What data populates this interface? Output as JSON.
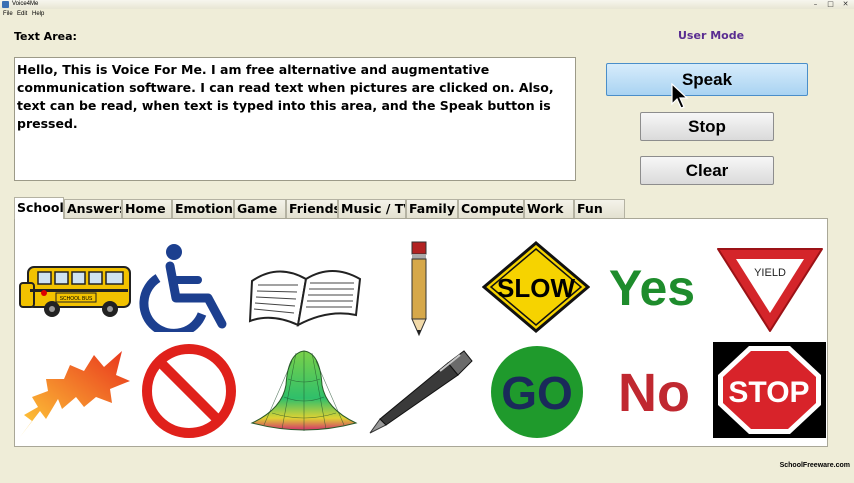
{
  "window": {
    "title": "Voice4Me"
  },
  "menu": [
    "File",
    "Edit",
    "Help"
  ],
  "labels": {
    "text_area": "Text Area:",
    "mode": "User Mode"
  },
  "text_area": {
    "value": "Hello, This is Voice For Me. I am free alternative and augmentative communication software. I can read text when pictures are clicked on. Also, text can be read, when text is typed into this area, and the Speak button is pressed."
  },
  "buttons": {
    "speak": "Speak",
    "stop": "Stop",
    "clear": "Clear"
  },
  "tabs": [
    "School",
    "Answers",
    "Home",
    "Emotions",
    "Game",
    "Friends",
    "Music / TV",
    "Family",
    "Computer",
    "Work",
    "Fun"
  ],
  "active_tab": "School",
  "pictures": {
    "bus_sign": "SCHOOL BUS",
    "slow": "SLOW",
    "yes": "Yes",
    "yield": "YIELD",
    "go": "GO",
    "no": "No",
    "stop": "STOP"
  },
  "footer": "SchoolFreeware.com",
  "colors": {
    "user_mode": "#5a2d91",
    "speak_button": "#a9d3f2",
    "background": "#efedd8"
  }
}
